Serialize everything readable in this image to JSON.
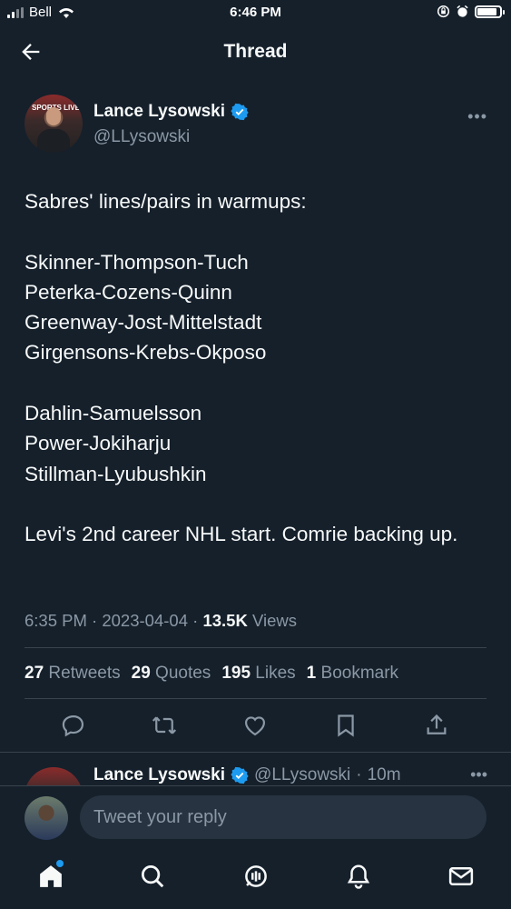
{
  "status_bar": {
    "carrier": "Bell",
    "time": "6:46 PM"
  },
  "header": {
    "title": "Thread"
  },
  "tweet": {
    "author_name": "Lance Lysowski",
    "author_handle": "@LLysowski",
    "avatar_text": "SPORTS LIVE",
    "text": "Sabres' lines/pairs in warmups:\n\nSkinner-Thompson-Tuch\nPeterka-Cozens-Quinn\nGreenway-Jost-Mittelstadt\nGirgensons-Krebs-Okposo\n\nDahlin-Samuelsson\nPower-Jokiharju\nStillman-Lyubushkin\n\nLevi's 2nd career NHL start. Comrie backing up.",
    "time": "6:35 PM",
    "date": "2023-04-04",
    "views_count": "13.5K",
    "views_label": "Views",
    "stats": [
      {
        "count": "27",
        "label": "Retweets"
      },
      {
        "count": "29",
        "label": "Quotes"
      },
      {
        "count": "195",
        "label": "Likes"
      },
      {
        "count": "1",
        "label": "Bookmark"
      }
    ]
  },
  "reply_preview": {
    "author_name": "Lance Lysowski",
    "author_handle": "@LLysowski",
    "age": "10m"
  },
  "reply_bar": {
    "placeholder": "Tweet your reply"
  },
  "colors": {
    "background": "#15202b",
    "accent": "#1d9bf0",
    "muted": "#8b98a5",
    "divider": "#38444d"
  },
  "icons": [
    "back-arrow-icon",
    "verified-badge-icon",
    "more-icon",
    "reply-icon",
    "retweet-icon",
    "like-icon",
    "bookmark-icon",
    "share-icon",
    "home-icon",
    "search-icon",
    "spaces-icon",
    "notifications-icon",
    "messages-icon"
  ]
}
